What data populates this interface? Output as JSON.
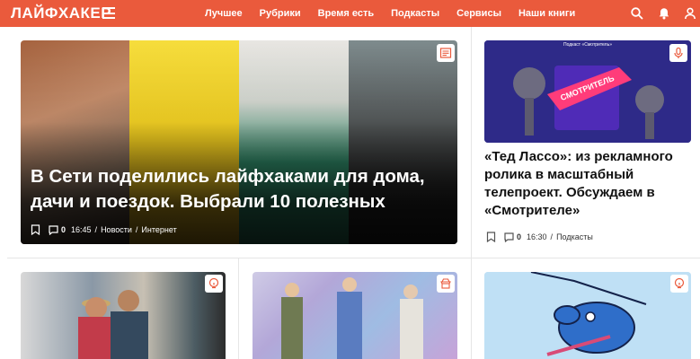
{
  "header": {
    "logo": "ЛАЙФХАКЕР",
    "nav": [
      "Лучшее",
      "Рубрики",
      "Время есть",
      "Подкасты",
      "Сервисы",
      "Наши книги"
    ],
    "bg_color": "#ea5a3c"
  },
  "main_article": {
    "title": "В Сети поделились лайфхаками для дома, дачи и поездок. Выбрали 10 полезных",
    "comments": "0",
    "time": "16:45",
    "category": "Новости",
    "subcategory": "Интернет",
    "badge_icon": "article-icon"
  },
  "side_article": {
    "title": "«Тед Лассо»: из рекламного ролика в масштабный телепроект. Обсуждаем в «Смотрителе»",
    "image_caption": "Подкаст «Смотритель»",
    "image_label": "СМОТРИТЕЛЬ",
    "comments": "0",
    "time": "16:30",
    "category": "Подкасты",
    "badge_icon": "microphone-icon"
  },
  "bottom_cards": [
    {
      "badge_icon": "brain-icon"
    },
    {
      "badge_icon": "shop-icon"
    },
    {
      "badge_icon": "brain-icon"
    }
  ],
  "separator": "/"
}
